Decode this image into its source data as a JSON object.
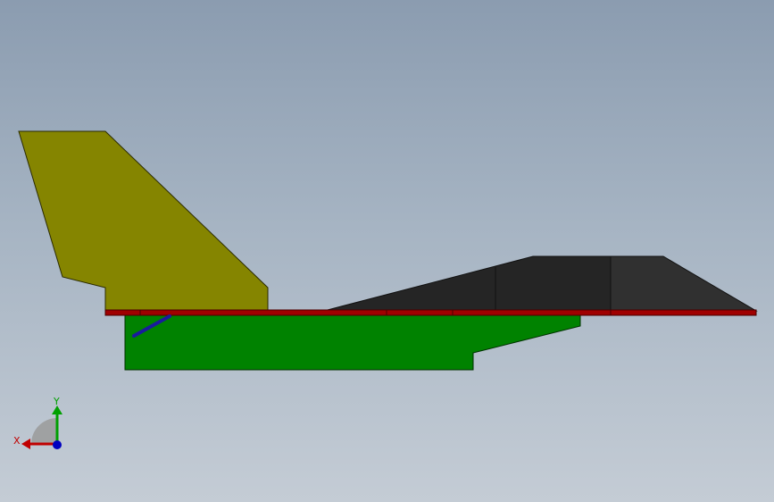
{
  "viewport": {
    "background_top": "#8b9cb0",
    "background_bottom": "#c4ccd5"
  },
  "model": {
    "parts": [
      {
        "name": "vertical-tail",
        "color": "#858500"
      },
      {
        "name": "fuselage-body",
        "color": "#008200"
      },
      {
        "name": "wing-plate",
        "color": "#a00000"
      },
      {
        "name": "nose-section",
        "color": "#252525"
      },
      {
        "name": "strut",
        "color": "#1a1a9e"
      }
    ]
  },
  "triad": {
    "x_label": "X",
    "y_label": "Y",
    "x_color": "#c00000",
    "y_color": "#00a000",
    "z_color": "#0000c0"
  }
}
